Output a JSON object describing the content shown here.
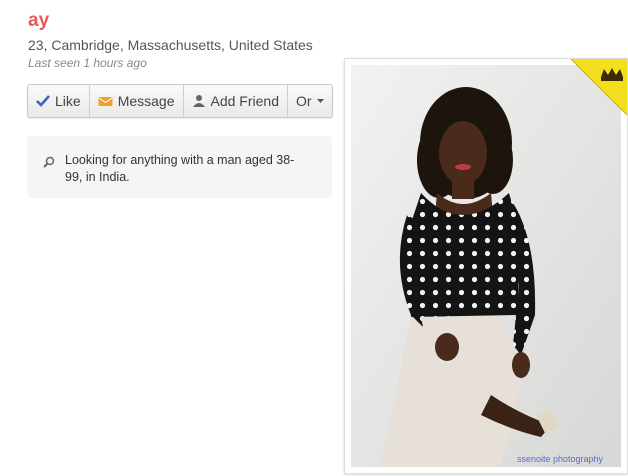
{
  "profile": {
    "name": "ay",
    "location": "23, Cambridge, Massachusetts, United States",
    "last_seen": "Last seen 1 hours ago"
  },
  "actions": {
    "like": "Like",
    "message": "Message",
    "add_friend": "Add Friend",
    "more": "Or"
  },
  "looking_for": {
    "text": "Looking for anything with a man aged 38-99, in India."
  },
  "photo": {
    "credit": "ssenoite photography"
  },
  "colors": {
    "name": "#e8595a",
    "crown_badge": "#f3df1e"
  },
  "icons": [
    "checkmark-icon",
    "message-icon",
    "person-icon",
    "caret-down-icon",
    "search-icon",
    "crown-icon"
  ]
}
